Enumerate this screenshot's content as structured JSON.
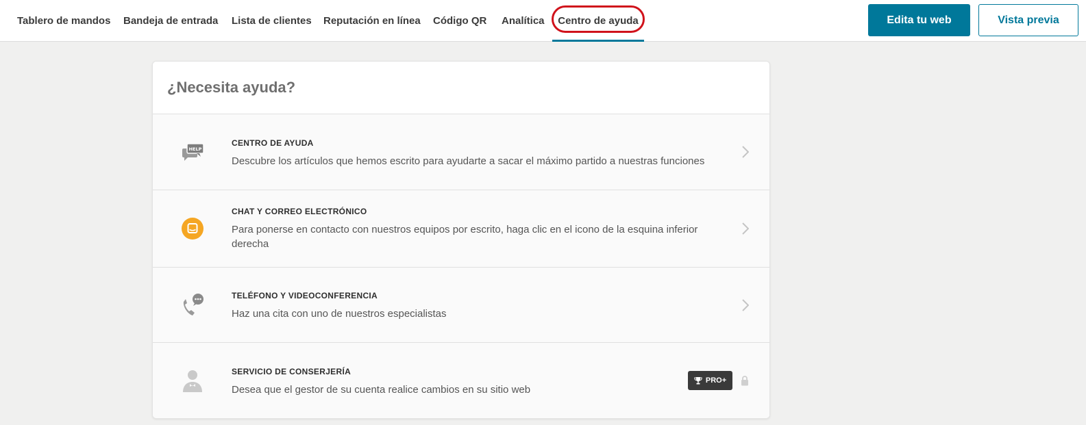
{
  "nav": {
    "tabs": [
      {
        "label": "Tablero de mandos"
      },
      {
        "label": "Bandeja de entrada"
      },
      {
        "label": "Lista de clientes"
      },
      {
        "label": "Reputación en línea"
      },
      {
        "label": "Código QR"
      },
      {
        "label": "Analítica"
      },
      {
        "label": "Centro de ayuda",
        "active": true
      }
    ],
    "edit_button": "Edita tu web",
    "preview_button": "Vista previa"
  },
  "help": {
    "title": "¿Necesita ayuda?",
    "items": [
      {
        "icon": "help-chat-icon",
        "title": "CENTRO DE AYUDA",
        "description": "Descubre los artículos que hemos escrito para ayudarte a sacar el máximo partido a nuestras funciones",
        "icon_text": "HELP"
      },
      {
        "icon": "chat-bubble-icon",
        "title": "CHAT Y CORREO ELECTRÓNICO",
        "description": "Para ponerse en contacto con nuestros equipos por escrito, haga clic en el icono de la esquina inferior derecha"
      },
      {
        "icon": "phone-chat-icon",
        "title": "TELÉFONO Y VIDEOCONFERENCIA",
        "description": "Haz una cita con uno de nuestros especialistas"
      },
      {
        "icon": "concierge-icon",
        "title": "SERVICIO DE CONSERJERÍA",
        "description": "Desea que el gestor de su cuenta realice cambios en su sitio web",
        "badge": "PRO+",
        "locked": true
      }
    ]
  },
  "colors": {
    "accent": "#00789a",
    "highlight": "#d0121b",
    "chat_icon": "#f5a623"
  }
}
